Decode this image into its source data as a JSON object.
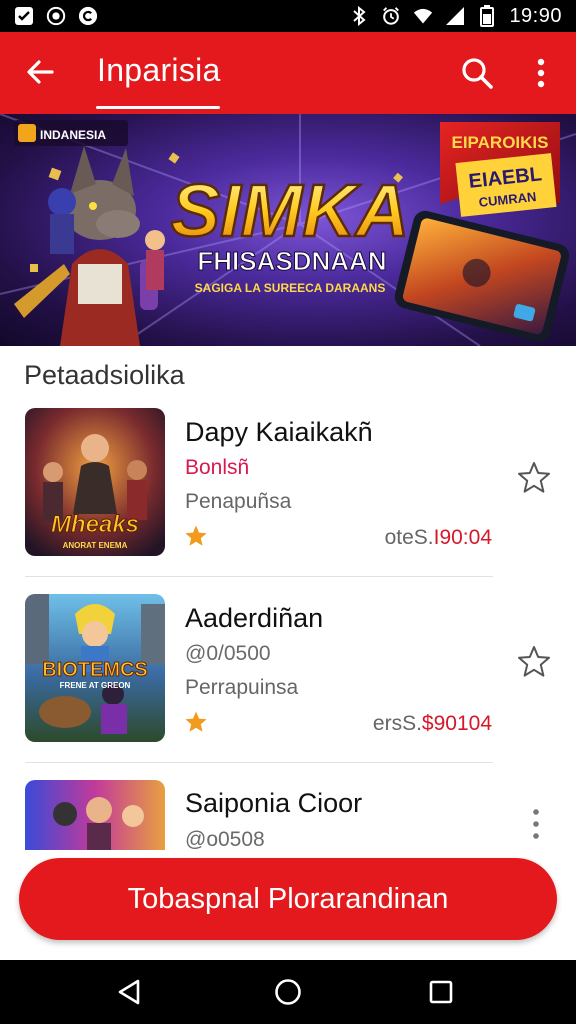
{
  "status_bar": {
    "time": "19:90",
    "left_icons": [
      "checkbox-icon",
      "camera-icon",
      "copyright-icon"
    ],
    "right_icons": [
      "bluetooth-icon",
      "alarm-icon",
      "wifi-icon",
      "signal-icon",
      "battery-icon"
    ]
  },
  "app_bar": {
    "title": "Inparisia",
    "back_icon": "arrow-back-icon",
    "search_icon": "search-icon",
    "more_icon": "more-vert-icon"
  },
  "banner": {
    "badge": "INDANESIA",
    "headline": "SIMKA",
    "subheadline": "FHISASDNAAN",
    "tagline": "SAGIGA LA SUREECA DARAANS",
    "ribbon_line1": "EIPAROIKIS",
    "ribbon_line2": "EIAEBL",
    "ribbon_line3": "CUMRAN"
  },
  "section": {
    "title": "Petaadsiolika"
  },
  "games": [
    {
      "title": "Dapy Kaiaikakñ",
      "subtitle": "Bonlsñ",
      "subtitle_color": "#d9194f",
      "category": "Penapuñsa",
      "price_prefix": "oteS.",
      "price": "I90:04",
      "thumb_label": "Mheaks",
      "thumb_caption": "ANORAT ENEMA",
      "action_icon": "star-outline-icon"
    },
    {
      "title": "Aaderdiñan",
      "subtitle": "@0/0500",
      "subtitle_color": "#6a6a6a",
      "category": "Perrapuinsa",
      "price_prefix": "ersS.",
      "price": "$90104",
      "thumb_label": "BIOTEMCS",
      "thumb_caption": "FRENE AT GREON",
      "action_icon": "star-outline-icon"
    },
    {
      "title": "Saiponia Cioor",
      "subtitle": "@o0508",
      "subtitle_color": "#6a6a6a",
      "action_icon": "more-vert-icon"
    }
  ],
  "cta": {
    "label": "Tobaspnal Plorarandinan"
  },
  "nav_bar": {
    "icons": [
      "back-triangle-icon",
      "home-circle-icon",
      "recents-square-icon"
    ]
  },
  "colors": {
    "primary": "#e3191d",
    "price": "#d5182a",
    "rating_star": "#f29a1e"
  }
}
